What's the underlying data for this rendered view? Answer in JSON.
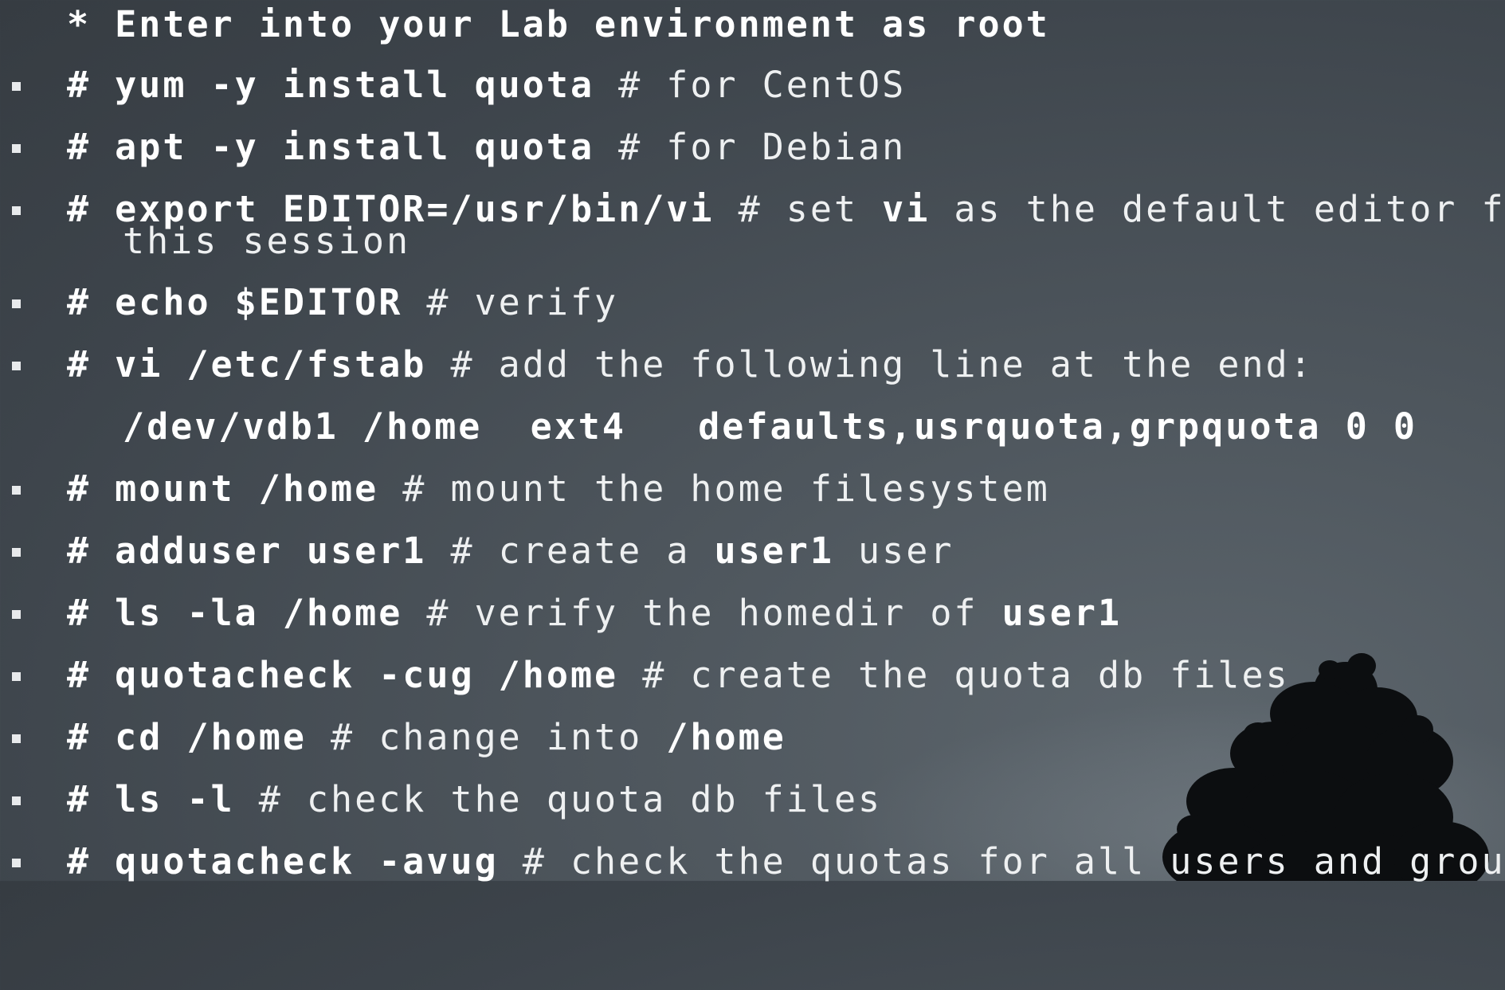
{
  "header": {
    "text": "* Enter into your Lab environment as root"
  },
  "items": [
    {
      "cmd": "# yum -y install quota",
      "comment": " # for CentOS"
    },
    {
      "cmd": "# apt -y install quota",
      "comment": " # for Debian"
    },
    {
      "cmd": "# export EDITOR=/usr/bin/vi",
      "comment": " # set ",
      "bold2": "vi",
      "comment2": " as the default editor for",
      "wrap": "this session"
    },
    {
      "cmd": "# echo $EDITOR",
      "comment": " # verify"
    },
    {
      "cmd": "# vi /etc/fstab",
      "comment": " # add the following line at the end:"
    },
    {
      "cmd": "# mount /home",
      "comment": " # mount the home filesystem"
    },
    {
      "cmd": "# adduser user1",
      "comment": " # create a ",
      "bold2": "user1",
      "comment2": " user"
    },
    {
      "cmd": "# ls -la /home",
      "comment": " # verify the homedir of ",
      "bold2": "user1"
    },
    {
      "cmd": "# quotacheck -cug /home",
      "comment": " # create the quota db files"
    },
    {
      "cmd": "# cd /home",
      "comment": " # change into ",
      "bold2": "/home"
    },
    {
      "cmd": "# ls -l",
      "comment": " # check the quota db files"
    },
    {
      "cmd": "# quotacheck -avug",
      "comment": " # check the quotas for all users and groups"
    }
  ],
  "fstab_line": "/dev/vdb1 /home  ext4   defaults,usrquota,grpquota 0 0"
}
